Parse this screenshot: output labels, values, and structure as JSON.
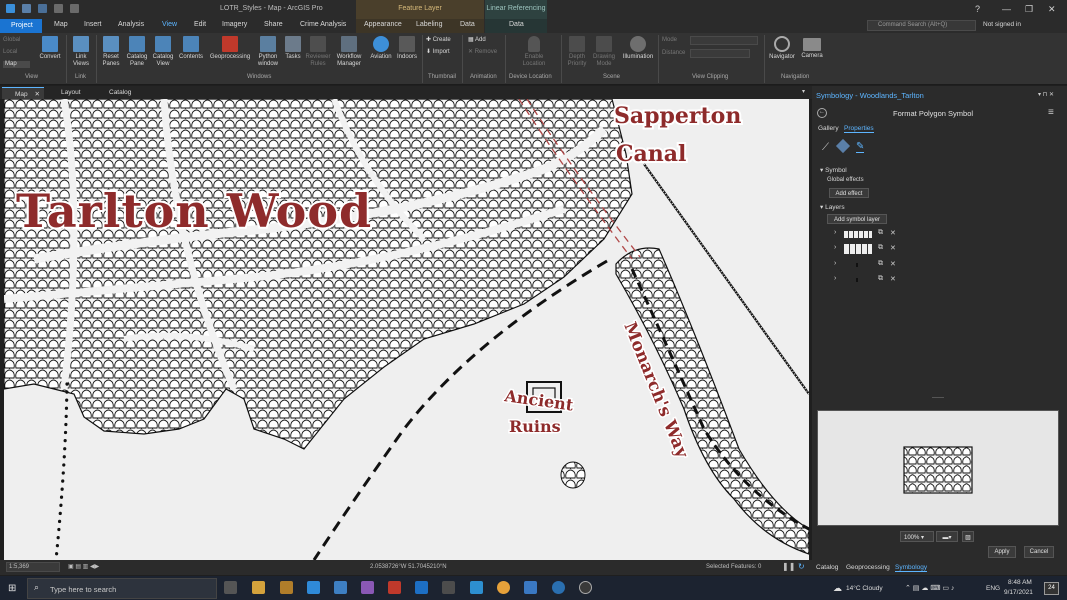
{
  "window": {
    "title": "LOTR_Styles - Map - ArcGIS Pro",
    "context_feature": "Feature Layer",
    "context_linear": "Linear Referencing"
  },
  "tabs": [
    "Project",
    "Map",
    "Insert",
    "Analysis",
    "View",
    "Edit",
    "Imagery",
    "Share",
    "Crime Analysis",
    "Appearance",
    "Labeling",
    "Data",
    "Data"
  ],
  "active_tab": "View",
  "search_placeholder": "Command Search (Alt+Q)",
  "signin": "Not signed in",
  "ribbon": {
    "view_items": [
      "Global",
      "Local",
      "Map"
    ],
    "convert": "Convert",
    "link_views": "Link Views",
    "reset_panes": "Reset Panes",
    "catalog_pane": "Catalog Pane",
    "catalog_view": "Catalog View",
    "contents": "Contents",
    "geoprocessing": "Geoprocessing",
    "python": "Python window",
    "tasks": "Tasks",
    "reviewer": "Reviewer Rules",
    "workflow": "Workflow Manager",
    "aviation": "Aviation",
    "indoors": "Indoors",
    "create": "Create",
    "import": "Import",
    "add": "Add",
    "remove": "Remove",
    "enable_location": "Enable Location",
    "depth_priority": "Depth Priority",
    "drawing_mode": "Drawing Mode",
    "illumination": "Illumination",
    "mode": "Mode",
    "distance": "Distance",
    "navigator": "Navigator",
    "camera": "Camera",
    "groups": [
      "View",
      "Link",
      "Windows",
      "Thumbnail",
      "Animation",
      "Device Location",
      "Scene",
      "View Clipping",
      "Navigation"
    ]
  },
  "view_tabs": [
    "Map",
    "Layout",
    "Catalog"
  ],
  "map_labels": {
    "wood": "Tarlton Wood",
    "sapperton": "Sapperton",
    "canal": "Canal",
    "ancient": "Ancient",
    "ruins": "Ruins",
    "monarch": "Monarch's Way"
  },
  "status": {
    "scale": "1:5,369",
    "coords": "2.0538726°W 51.7045210°N",
    "selected": "Selected Features: 0"
  },
  "panel": {
    "title": "Symbology - Woodlands_Tarlton",
    "subtitle": "Format Polygon Symbol",
    "tab_gallery": "Gallery",
    "tab_properties": "Properties",
    "symbol": "Symbol",
    "global_effects": "Global effects",
    "add_effect": "Add effect",
    "layers": "Layers",
    "add_symbol_layer": "Add symbol layer",
    "zoom": "100%",
    "apply": "Apply",
    "cancel": "Cancel",
    "bottom_tabs": [
      "Catalog",
      "Geoprocessing",
      "Symbology"
    ]
  },
  "taskbar": {
    "search": "Type here to search",
    "weather": "14°C Cloudy",
    "lang": "ENG",
    "time": "8:48 AM",
    "date": "9/17/2021",
    "notif": "24"
  },
  "colors": {
    "accent": "#5db5ff",
    "project_tab": "#1a74d2",
    "map_label": "#8e2b2b",
    "map_bg": "#efefef",
    "feature_ctx": "#4a3f2b",
    "linear_ctx": "#2e4240"
  }
}
